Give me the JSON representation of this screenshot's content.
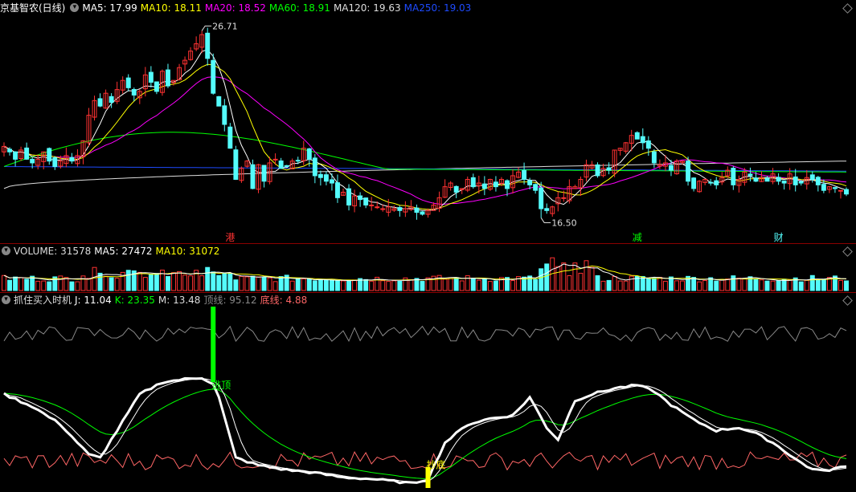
{
  "header": {
    "stock_name": "京基智农(日线)",
    "ma_items": [
      {
        "label": "MA5: 17.99",
        "color": "#ffffff"
      },
      {
        "label": "MA10: 18.11",
        "color": "#ffff00"
      },
      {
        "label": "MA20: 18.52",
        "color": "#ff00ff"
      },
      {
        "label": "MA60: 18.91",
        "color": "#00ff00"
      },
      {
        "label": "MA120: 19.63",
        "color": "#dddddd"
      },
      {
        "label": "MA250: 19.03",
        "color": "#1e4bff"
      }
    ]
  },
  "volume_header": {
    "title": "VOLUME: 31578",
    "items": [
      {
        "label": "MA5: 27472",
        "color": "#ffffff"
      },
      {
        "label": "MA10: 31072",
        "color": "#ffff00"
      }
    ]
  },
  "indicator_header": {
    "title": "抓住买入时机",
    "items": [
      {
        "label": "J: 11.04",
        "color": "#ffffff"
      },
      {
        "label": "K: 23.35",
        "color": "#00ff00"
      },
      {
        "label": "M: 13.48",
        "color": "#dddddd"
      },
      {
        "label": "顶线: 95.12",
        "color": "#888888"
      },
      {
        "label": "底线: 4.88",
        "color": "#ff6666"
      }
    ]
  },
  "colors": {
    "up": "#ff3232",
    "down": "#54fcfc",
    "ma5": "#ffffff",
    "ma10": "#ffff00",
    "ma20": "#ff00ff",
    "ma60": "#00ff00",
    "ma120": "#dddddd",
    "ma250": "#1e4bff",
    "separator": "#8b0000"
  },
  "chart_data": [
    {
      "type": "candlestick",
      "name": "price",
      "count": 150,
      "ylim": [
        15.6,
        27.6
      ],
      "high_marker": {
        "index": 35,
        "value": 26.71,
        "label": "26.71"
      },
      "low_marker": {
        "index": 95,
        "value": 16.5,
        "label": "16.50"
      },
      "closes": [
        20.4,
        20.1,
        19.7,
        20.2,
        19.7,
        19.5,
        19.7,
        20.1,
        19.6,
        19.3,
        19.6,
        19.9,
        19.6,
        19.9,
        20.7,
        22.1,
        22.9,
        22.6,
        23.3,
        22.8,
        23.5,
        24.0,
        23.6,
        23.2,
        23.4,
        24.3,
        23.9,
        23.4,
        24.5,
        23.7,
        24.0,
        24.7,
        25.1,
        25.6,
        26.0,
        26.5,
        25.2,
        23.3,
        22.6,
        21.6,
        20.3,
        18.6,
        19.2,
        19.6,
        18.1,
        19.4,
        18.5,
        19.5,
        19.7,
        19.2,
        19.3,
        19.6,
        19.6,
        20.3,
        19.7,
        18.8,
        18.7,
        18.5,
        18.4,
        17.6,
        17.9,
        17.2,
        17.7,
        17.5,
        17.2,
        17.2,
        17.1,
        17.0,
        17.1,
        17.0,
        16.9,
        17.0,
        17.1,
        16.8,
        16.7,
        16.9,
        17.2,
        17.6,
        18.2,
        18.4,
        17.9,
        18.1,
        18.6,
        18.2,
        18.4,
        18.1,
        18.6,
        18.2,
        18.6,
        18.1,
        18.8,
        19.0,
        18.6,
        18.3,
        18.0,
        17.0,
        16.9,
        17.1,
        17.6,
        17.6,
        18.2,
        18.2,
        18.6,
        19.4,
        19.4,
        18.8,
        19.2,
        19.1,
        20.2,
        20.3,
        20.6,
        21.0,
        20.8,
        20.6,
        20.3,
        19.5,
        19.4,
        19.5,
        19.1,
        19.6,
        19.6,
        18.5,
        18.1,
        18.5,
        18.6,
        18.4,
        18.3,
        18.7,
        19.1,
        18.3,
        18.6,
        19.0,
        18.8,
        18.5,
        18.7,
        18.5,
        18.9,
        18.5,
        18.4,
        18.9,
        18.3,
        18.4,
        18.7,
        18.6,
        18.3,
        18.0,
        18.2,
        18.1,
        18.0,
        17.8
      ],
      "markers": [
        {
          "index": 40,
          "text": "港",
          "color": "#ff3232"
        },
        {
          "index": 112,
          "text": "减",
          "color": "#00ff00"
        },
        {
          "index": 137,
          "text": "财",
          "color": "#54fcfc"
        }
      ]
    },
    {
      "type": "bar",
      "name": "volume",
      "count": 150,
      "ylim": [
        0,
        70000
      ]
    },
    {
      "type": "line",
      "name": "indicator",
      "ylim": [
        0,
        120
      ],
      "top_line": 95.12,
      "bottom_line": 4.88,
      "signals": [
        {
          "index": 37,
          "text": "逃顶",
          "color": "#00ff00"
        },
        {
          "index": 75,
          "text": "抄底",
          "color": "#ffff00"
        }
      ]
    }
  ]
}
